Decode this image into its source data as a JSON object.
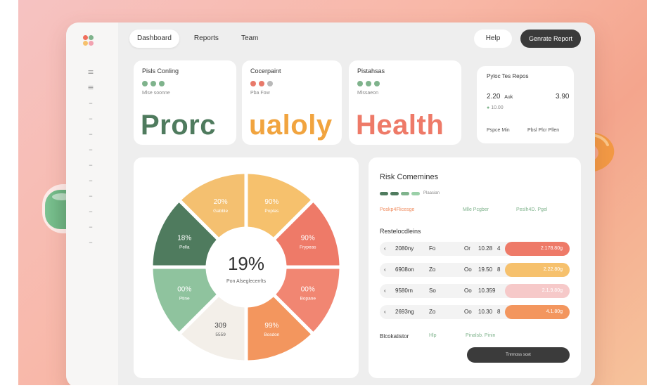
{
  "topnav": {
    "tabs": [
      {
        "label": "Dashboard",
        "active": true
      },
      {
        "label": "Reports",
        "active": false
      },
      {
        "label": "Team",
        "active": false
      }
    ],
    "help_label": "Help",
    "generate_label": "Genrate Report"
  },
  "sidebar": {
    "icons": [
      "≡",
      "≡",
      "–",
      "–",
      "–",
      "–",
      "–",
      "–",
      "–",
      "–",
      "–",
      "–"
    ]
  },
  "kpis": [
    {
      "title": "Pisls Conling",
      "sub": "Mlse soonne",
      "word": "Prorc",
      "dots": [
        "#7fb38c",
        "#7fb38c",
        "#7fb38c"
      ]
    },
    {
      "title": "Cocerpaint",
      "sub": "Pba Fow",
      "word": "ualoly",
      "dots": [
        "#e8796a",
        "#e8796a",
        "#b9b9b9"
      ]
    },
    {
      "title": "Pistahsas",
      "sub": "Mlssaeon",
      "word": "Health",
      "dots": [
        "#7fb38c",
        "#7fb38c",
        "#7fb38c"
      ]
    }
  ],
  "summary": {
    "title": "Pyloc Tes Repos",
    "value_left": "2.20",
    "value_left_unit": "Auk",
    "value_right": "3.90",
    "note": "10.00",
    "foot_left": "Pspce Min",
    "foot_right": "Pbsl Plcr Pllen"
  },
  "pie": {
    "center_value": "19%",
    "center_label": "Pon Alseglecerrlts",
    "segments": [
      {
        "value": "90%",
        "label": "Poplas",
        "color": "#f6c16d"
      },
      {
        "value": "90%",
        "label": "Frypeas",
        "color": "#ee7a68"
      },
      {
        "value": "00%",
        "label": "Bopane",
        "color": "#f18672"
      },
      {
        "value": "99%",
        "label": "Bosdon",
        "color": "#f3965e"
      },
      {
        "value": "309",
        "label": "5559",
        "color": "#f3efe9"
      },
      {
        "value": "00%",
        "label": "Ptine",
        "color": "#8fc39e"
      },
      {
        "value": "18%",
        "label": "Pella",
        "color": "#4f7b5e"
      },
      {
        "value": "20%",
        "label": "Gabble",
        "color": "#f4c070"
      }
    ]
  },
  "risk": {
    "title": "Risk Comemines",
    "legend_label": "Plaasian",
    "legend_colors": [
      "#4f7b5e",
      "#4f7b5e",
      "#7fb38c",
      "#9ad0a8"
    ],
    "categories": [
      {
        "label": "Poskp4Flicesge",
        "color": "#f08b5e"
      },
      {
        "label": "Mlle Pcgber",
        "color": "#7fb38c"
      },
      {
        "label": "Peslh4D. Pgel",
        "color": "#7fb38c"
      }
    ],
    "list_title": "Restelocdleins",
    "rows": [
      {
        "id": "2080ny",
        "col2": "Fo",
        "col3": "Or",
        "num": "10.28",
        "arrow": "4",
        "pill": "2.178.80g",
        "color": "#ee7a68"
      },
      {
        "id": "6908on",
        "col2": "Zo",
        "col3": "Oo",
        "num": "19.50",
        "arrow": "8",
        "pill": "2.22.80g",
        "color": "#f6c16d"
      },
      {
        "id": "9580rn",
        "col2": "So",
        "col3": "Oo",
        "num": "10.359",
        "arrow": "",
        "pill": "2.1.9.80g",
        "color": "#f6c9c9"
      },
      {
        "id": "2693ng",
        "col2": "Zo",
        "col3": "Oo",
        "num": "10.30",
        "arrow": "8",
        "pill": "4.1.80g",
        "color": "#f3965e"
      }
    ],
    "footer_left": "Blcokatistor",
    "footer_mid": "Hlp",
    "footer_right": "Pinalsb. Pinin",
    "dark_button": "Tnnnoss scet"
  }
}
